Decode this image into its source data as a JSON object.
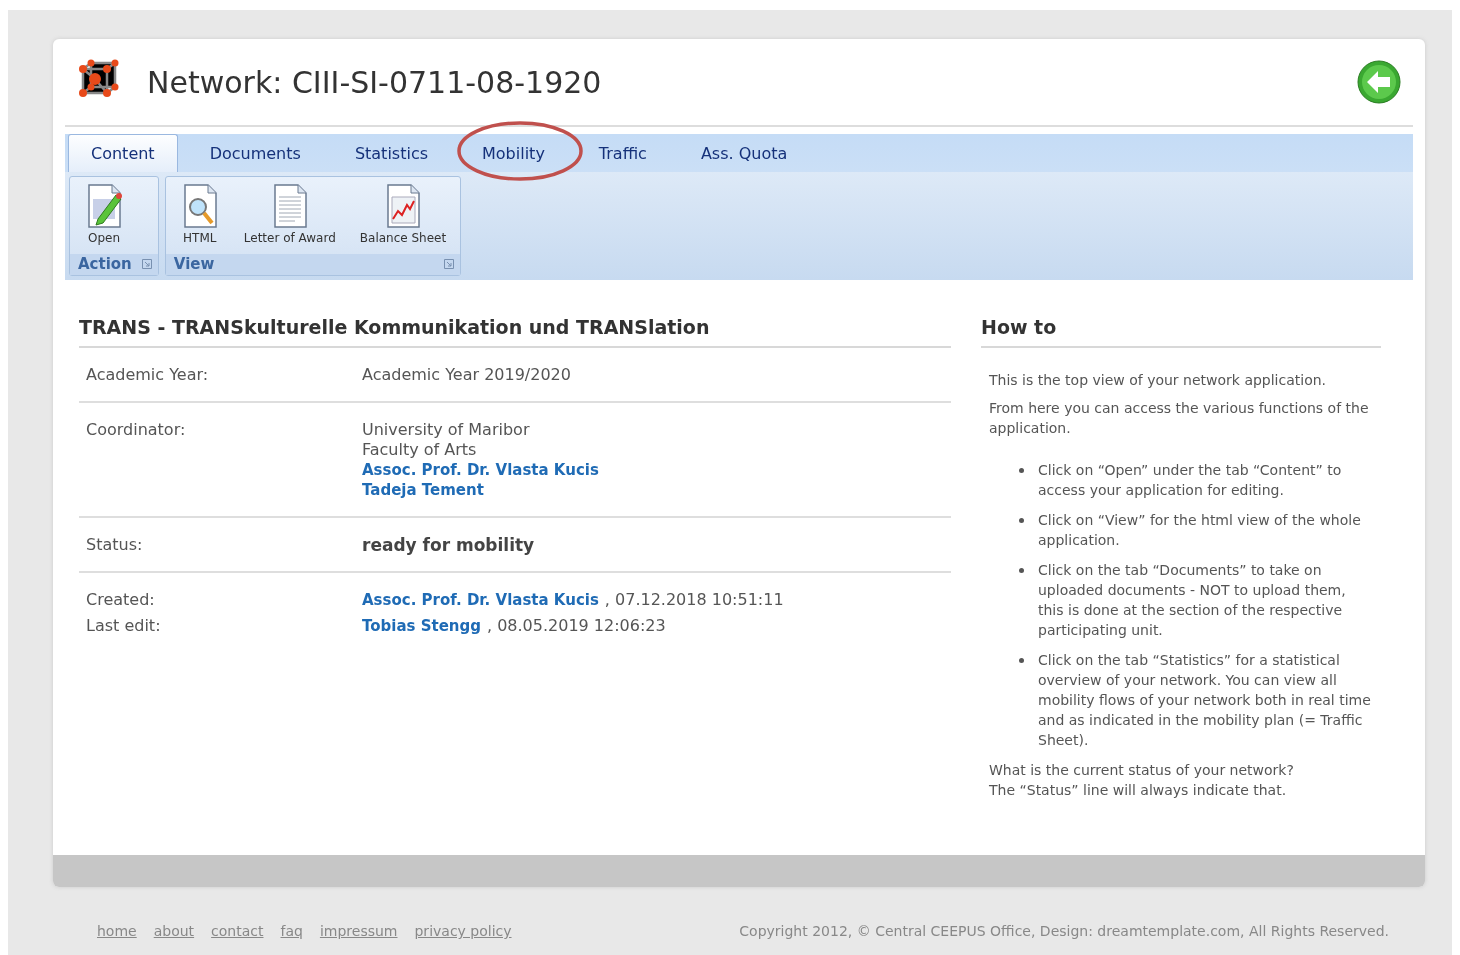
{
  "header": {
    "title": "Network: CIII-SI-0711-08-1920"
  },
  "tabs": [
    {
      "label": "Content",
      "selected": true,
      "circled": false
    },
    {
      "label": "Documents",
      "selected": false,
      "circled": false
    },
    {
      "label": "Statistics",
      "selected": false,
      "circled": false
    },
    {
      "label": "Mobility",
      "selected": false,
      "circled": true
    },
    {
      "label": "Traffic",
      "selected": false,
      "circled": false
    },
    {
      "label": "Ass. Quota",
      "selected": false,
      "circled": false
    }
  ],
  "ribbon_groups": [
    {
      "label": "Action",
      "items": [
        {
          "label": "Open",
          "kind": "edit"
        }
      ]
    },
    {
      "label": "View",
      "items": [
        {
          "label": "HTML",
          "kind": "search"
        },
        {
          "label": "Letter of Award",
          "kind": "document"
        },
        {
          "label": "Balance Sheet",
          "kind": "chart"
        }
      ]
    }
  ],
  "details": {
    "title": "TRANS - TRANSkulturelle Kommunikation und TRANSlation",
    "sections": [
      {
        "rows": [
          {
            "label": "Academic Year:",
            "lines": [
              [
                {
                  "text": "Academic Year 2019/2020",
                  "kind": "plain"
                }
              ]
            ]
          }
        ]
      },
      {
        "rows": [
          {
            "label": "Coordinator:",
            "lines": [
              [
                {
                  "text": "University of Maribor",
                  "kind": "plain"
                }
              ],
              [
                {
                  "text": "Faculty of Arts",
                  "kind": "plain"
                }
              ],
              [
                {
                  "text": "Assoc. Prof. Dr. Vlasta Kucis",
                  "kind": "link"
                }
              ],
              [
                {
                  "text": "Tadeja Tement",
                  "kind": "link"
                }
              ]
            ]
          }
        ]
      },
      {
        "rows": [
          {
            "label": "Status:",
            "lines": [
              [
                {
                  "text": "ready for mobility",
                  "kind": "bold"
                }
              ]
            ]
          }
        ]
      },
      {
        "rows": [
          {
            "label": "Created:",
            "lines": [
              [
                {
                  "text": "Assoc. Prof. Dr. Vlasta Kucis",
                  "kind": "link"
                },
                {
                  "text": ", 07.12.2018 10:51:11",
                  "kind": "plain"
                }
              ]
            ]
          },
          {
            "label": "Last edit:",
            "lines": [
              [
                {
                  "text": "Tobias Stengg",
                  "kind": "link"
                },
                {
                  "text": ", 08.05.2019 12:06:23",
                  "kind": "plain"
                }
              ]
            ]
          }
        ]
      }
    ]
  },
  "howto": {
    "title": "How to",
    "intro": [
      "This is the top view of your network application.",
      "From here you can access the various functions of the application."
    ],
    "bullets": [
      "Click on “Open” under the tab “Content” to access your application for editing.",
      "Click on “View” for the html view of the whole application.",
      "Click on the tab “Documents” to take on uploaded documents - NOT to upload them, this is done at the section of the respective participating unit.",
      "Click on the tab “Statistics” for a statistical overview of your network. You can view all mobility flows of your network both in real time and as indicated in the mobility plan (= Traffic Sheet)."
    ],
    "outro": [
      "What is the current status of your network?",
      "The “Status” line will always indicate that."
    ]
  },
  "footer": {
    "links": [
      "home",
      "about",
      "contact",
      "faq",
      "impressum",
      "privacy policy"
    ],
    "copyright": "Copyright 2012, © Central CEEPUS Office, Design: dreamtemplate.com, All Rights Reserved."
  }
}
